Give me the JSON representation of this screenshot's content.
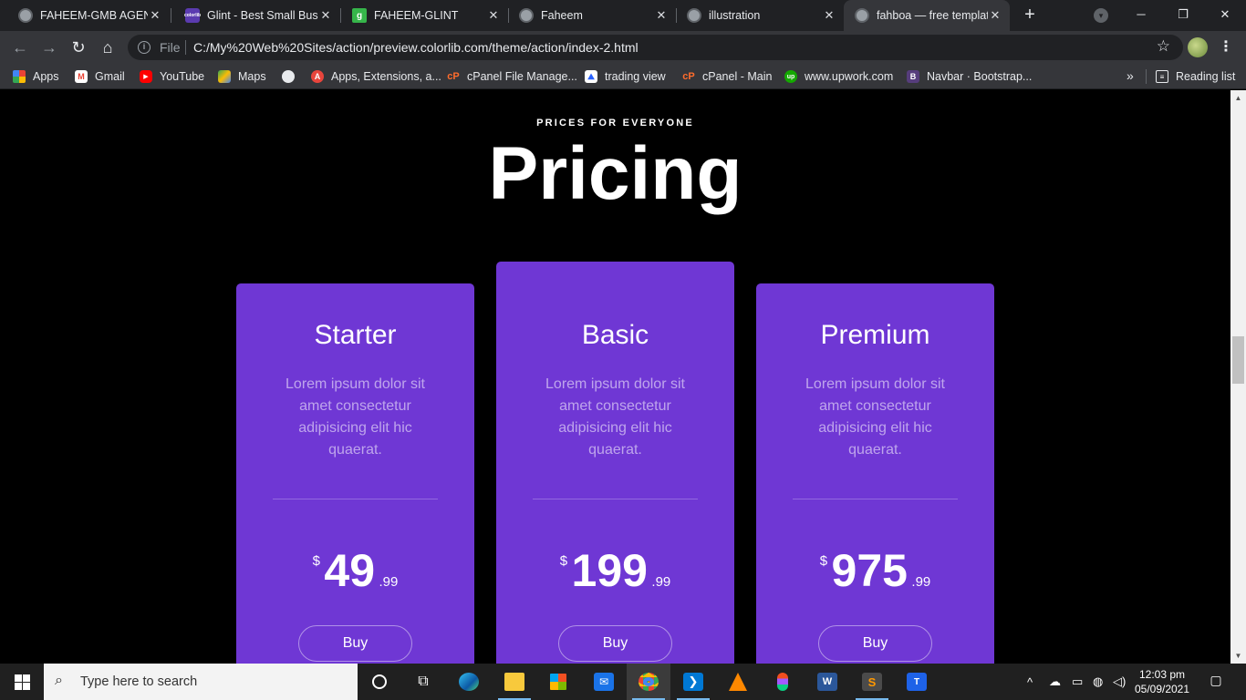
{
  "browser": {
    "tabs": [
      {
        "title": "FAHEEM-GMB AGENCY",
        "favicon": "globe-icon"
      },
      {
        "title": "Glint - Best Small Business",
        "favicon": "colorlib-icon"
      },
      {
        "title": "FAHEEM-GLINT",
        "favicon": "glint-g-icon"
      },
      {
        "title": "Faheem",
        "favicon": "globe-icon"
      },
      {
        "title": "illustration",
        "favicon": "globe-icon"
      },
      {
        "title": "fahboa — free template",
        "favicon": "globe-icon",
        "active": true
      }
    ],
    "address": {
      "file_label": "File",
      "url": "C:/My%20Web%20Sites/action/preview.colorlib.com/theme/action/index-2.html"
    },
    "bookmarks": [
      {
        "label": "Apps",
        "icon": "apps-grid-icon"
      },
      {
        "label": "Gmail",
        "icon": "gmail-icon"
      },
      {
        "label": "YouTube",
        "icon": "youtube-icon"
      },
      {
        "label": "Maps",
        "icon": "maps-icon"
      },
      {
        "label": "",
        "icon": "globe-icon"
      },
      {
        "label": "Apps, Extensions, a...",
        "icon": "extensions-icon"
      },
      {
        "label": "cPanel File Manage...",
        "icon": "cpanel-icon"
      },
      {
        "label": "trading view",
        "icon": "tradingview-icon"
      },
      {
        "label": "cPanel - Main",
        "icon": "cpanel-icon"
      },
      {
        "label": "www.upwork.com",
        "icon": "upwork-icon"
      },
      {
        "label": "Navbar · Bootstrap...",
        "icon": "bootstrap-icon"
      }
    ],
    "more_bookmarks": "»",
    "reading_list": "Reading list"
  },
  "page": {
    "subheading": "PRICES FOR EVERYONE",
    "heading": "Pricing",
    "plans": [
      {
        "name": "Starter",
        "description": "Lorem ipsum dolor sit amet consectetur adipisicing elit hic quaerat.",
        "currency": "$",
        "amount": "49",
        "cents": ".99",
        "button": "Buy"
      },
      {
        "name": "Basic",
        "description": "Lorem ipsum dolor sit amet consectetur adipisicing elit hic quaerat.",
        "currency": "$",
        "amount": "199",
        "cents": ".99",
        "button": "Buy"
      },
      {
        "name": "Premium",
        "description": "Lorem ipsum dolor sit amet consectetur adipisicing elit hic quaerat.",
        "currency": "$",
        "amount": "975",
        "cents": ".99",
        "button": "Buy"
      }
    ]
  },
  "taskbar": {
    "search_placeholder": "Type here to search",
    "time": "12:03 pm",
    "date": "05/09/2021"
  },
  "colors": {
    "card_purple": "#6f37d4",
    "page_bg": "#000000",
    "browser_dark": "#202124",
    "browser_toolbar": "#35363a"
  }
}
